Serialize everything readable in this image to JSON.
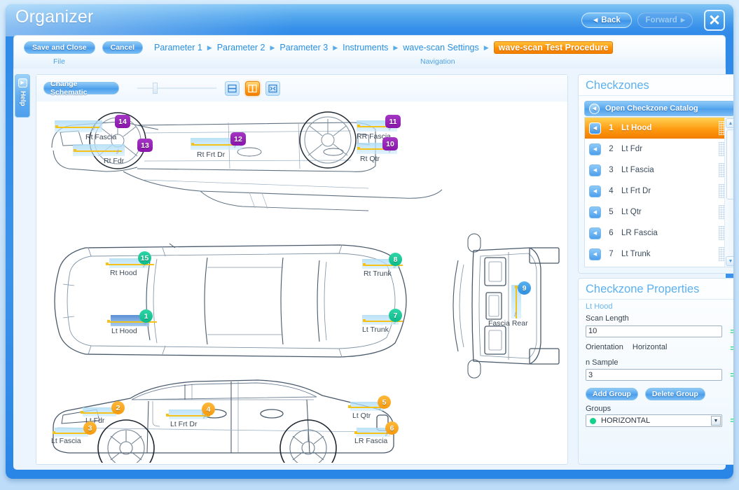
{
  "window": {
    "title": "Organizer",
    "back_label": "Back",
    "forward_label": "Forward",
    "close_label": "✕"
  },
  "ribbon": {
    "save_label": "Save and Close",
    "cancel_label": "Cancel",
    "file_group_label": "File",
    "navigation_group_label": "Navigation",
    "breadcrumbs": [
      {
        "label": "Parameter 1",
        "active": false
      },
      {
        "label": "Parameter 2",
        "active": false
      },
      {
        "label": "Parameter 3",
        "active": false
      },
      {
        "label": "Instruments",
        "active": false
      },
      {
        "label": "wave-scan Settings",
        "active": false
      },
      {
        "label": "wave-scan Test Procedure",
        "active": true
      }
    ]
  },
  "help_tab": {
    "label": "Help"
  },
  "schematic": {
    "change_button_label": "Change Schematic",
    "view_buttons": [
      {
        "icon": "horizontal-split-icon",
        "active": false
      },
      {
        "icon": "vertical-split-icon",
        "active": true
      },
      {
        "icon": "fit-to-screen-icon",
        "active": false
      }
    ],
    "zones": [
      {
        "num": "14",
        "label": "Rt Fascia",
        "color": "purple",
        "shape": "sq"
      },
      {
        "num": "13",
        "label": "Rt Fdr",
        "color": "purple",
        "shape": "sq"
      },
      {
        "num": "12",
        "label": "Rt Frt Dr",
        "color": "purple",
        "shape": "sq"
      },
      {
        "num": "11",
        "label": "RR Fascia",
        "color": "purple",
        "shape": "sq"
      },
      {
        "num": "10",
        "label": "Rt Qtr",
        "color": "purple",
        "shape": "sq"
      },
      {
        "num": "15",
        "label": "Rt Hood",
        "color": "green",
        "shape": "ci"
      },
      {
        "num": "8",
        "label": "Rt Trunk",
        "color": "green",
        "shape": "ci"
      },
      {
        "num": "1",
        "label": "Lt Hood",
        "color": "green",
        "shape": "ci",
        "selected": true
      },
      {
        "num": "7",
        "label": "Lt Trunk",
        "color": "green",
        "shape": "ci"
      },
      {
        "num": "9",
        "label": "Fascia Rear",
        "color": "blue",
        "shape": "ci"
      },
      {
        "num": "2",
        "label": "Lt Fdr",
        "color": "amber",
        "shape": "ci"
      },
      {
        "num": "3",
        "label": "Lt Fascia",
        "color": "amber",
        "shape": "ci"
      },
      {
        "num": "4",
        "label": "Lt Frt Dr",
        "color": "amber",
        "shape": "ci"
      },
      {
        "num": "5",
        "label": "Lt Qtr",
        "color": "amber",
        "shape": "ci"
      },
      {
        "num": "6",
        "label": "LR Fascia",
        "color": "amber",
        "shape": "ci"
      }
    ]
  },
  "checkzones": {
    "title": "Checkzones",
    "catalog_button_label": "Open Checkzone Catalog",
    "items": [
      {
        "num": "1",
        "label": "Lt Hood",
        "selected": true
      },
      {
        "num": "2",
        "label": "Lt Fdr",
        "selected": false
      },
      {
        "num": "3",
        "label": "Lt Fascia",
        "selected": false
      },
      {
        "num": "4",
        "label": "Lt Frt Dr",
        "selected": false
      },
      {
        "num": "5",
        "label": "Lt Qtr",
        "selected": false
      },
      {
        "num": "6",
        "label": "LR Fascia",
        "selected": false
      },
      {
        "num": "7",
        "label": "Lt Trunk",
        "selected": false
      }
    ]
  },
  "properties": {
    "title": "Checkzone Properties",
    "subtitle": "Lt Hood",
    "scan_length_label": "Scan Length",
    "scan_length_value": "10",
    "orientation_label": "Orientation",
    "orientation_value": "Horizontal",
    "n_sample_label": "n Sample",
    "n_sample_value": "3",
    "add_group_label": "Add Group",
    "delete_group_label": "Delete Group",
    "groups_label": "Groups",
    "groups_value": "HORIZONTAL",
    "equals_marker": "="
  },
  "colors": {
    "accent_blue": "#2f8ae8",
    "active_orange": "#ff9100",
    "marker_purple": "#8a16ab",
    "marker_green": "#0dbb8b",
    "marker_amber": "#f59a0d",
    "marker_blue": "#2f8fe0",
    "scan_line": "#f5c21a"
  }
}
